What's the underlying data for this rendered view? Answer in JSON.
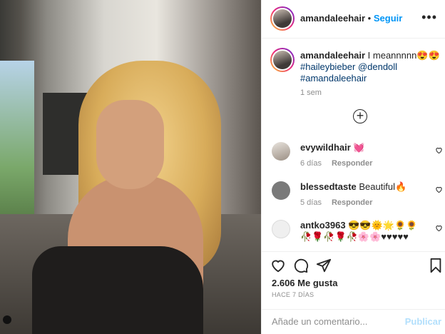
{
  "header": {
    "username": "amandaleehair",
    "separator": "•",
    "follow_label": "Seguir",
    "more_label": "•••"
  },
  "caption": {
    "username": "amandaleehair",
    "text": " I meannnnn😍😍",
    "tags": "#haileybieber @dendoll #amandaleehair",
    "time": "1 sem"
  },
  "load_more_label": "+",
  "comments": [
    {
      "username": "evywildhair",
      "text": " 💓",
      "time": "6 días",
      "reply": "Responder"
    },
    {
      "username": "blessedtaste",
      "text": " Beautiful🔥",
      "time": "5 días",
      "reply": "Responder"
    },
    {
      "username": "antko3963",
      "text": " 😎😎🌞🌟🌻🌻🥀🌹🥀🌹🥀🌸🌸♥♥♥♥♥",
      "time": "",
      "reply": ""
    }
  ],
  "actions": {
    "likes": "2.606 Me gusta",
    "posted": "HACE 7 DÍAS"
  },
  "add_comment": {
    "placeholder": "Añade un comentario...",
    "publish_label": "Publicar"
  },
  "colors": {
    "accent": "#0095f6",
    "publish_disabled": "#b2dffc",
    "tag_link": "#00376b",
    "muted": "#8e8e8e"
  }
}
